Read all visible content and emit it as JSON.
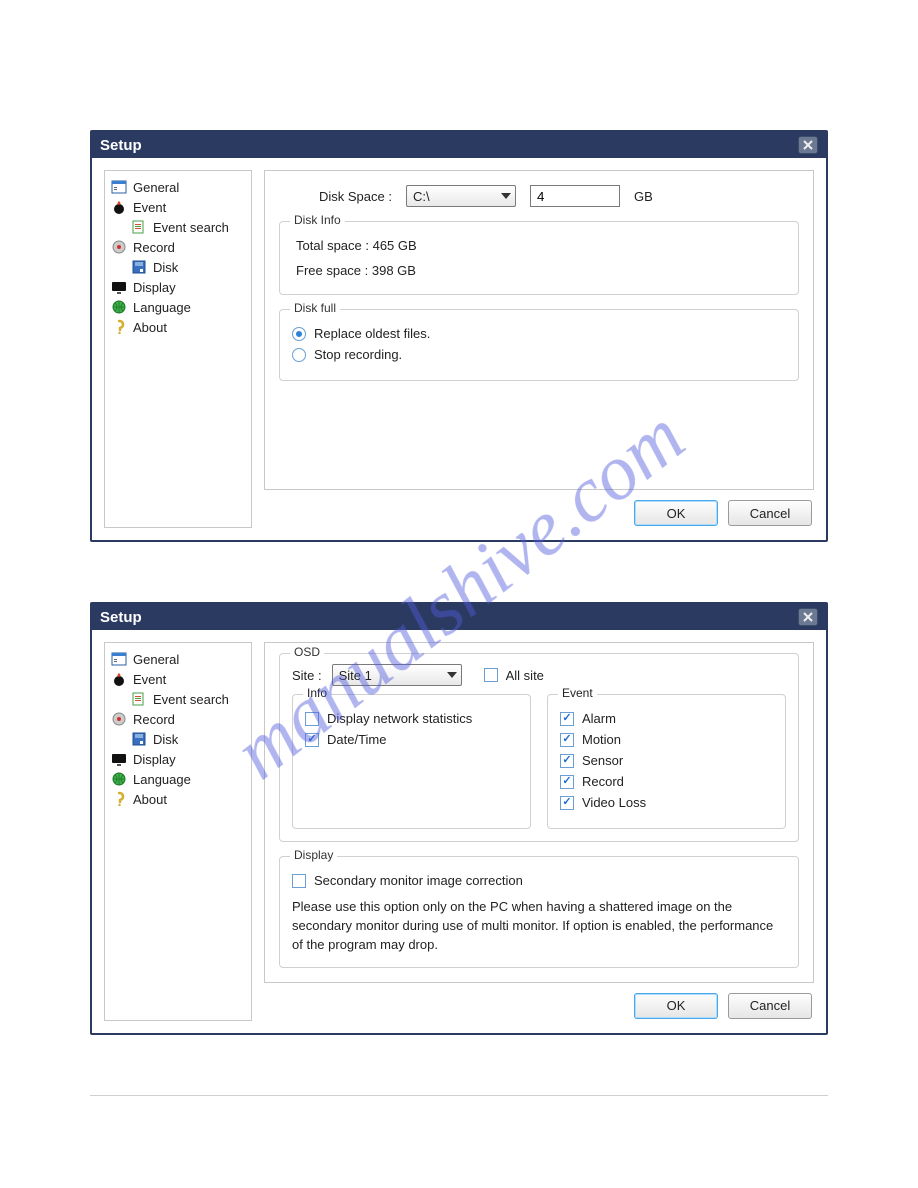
{
  "watermark": "manualshive.com",
  "sidebar": {
    "items": [
      {
        "label": "General",
        "icon": "general-icon"
      },
      {
        "label": "Event",
        "icon": "event-icon"
      },
      {
        "label": "Event search",
        "icon": "event-search-icon",
        "child": true
      },
      {
        "label": "Record",
        "icon": "record-icon"
      },
      {
        "label": "Disk",
        "icon": "disk-icon",
        "child": true
      },
      {
        "label": "Display",
        "icon": "display-icon"
      },
      {
        "label": "Language",
        "icon": "language-icon"
      },
      {
        "label": "About",
        "icon": "about-icon"
      }
    ]
  },
  "dialog1": {
    "title": "Setup",
    "diskSpace": {
      "label": "Disk Space :",
      "drive": "C:\\",
      "size": "4",
      "unit": "GB"
    },
    "diskInfo": {
      "legend": "Disk Info",
      "total": "Total space : 465 GB",
      "free": "Free space : 398 GB"
    },
    "diskFull": {
      "legend": "Disk full",
      "opt1": "Replace oldest files.",
      "opt2": "Stop recording."
    },
    "ok": "OK",
    "cancel": "Cancel"
  },
  "dialog2": {
    "title": "Setup",
    "osd": {
      "legend": "OSD",
      "siteLabel": "Site :",
      "siteValue": "Site 1",
      "allSite": "All site",
      "info": {
        "legend": "Info",
        "opt1": "Display network statistics",
        "opt2": "Date/Time"
      },
      "event": {
        "legend": "Event",
        "items": [
          "Alarm",
          "Motion",
          "Sensor",
          "Record",
          "Video Loss"
        ]
      }
    },
    "display": {
      "legend": "Display",
      "opt": "Secondary monitor image correction",
      "note": "Please use this option only on the PC when having a shattered image on the secondary monitor during use of multi monitor. If option is enabled, the performance of the program may drop."
    },
    "ok": "OK",
    "cancel": "Cancel"
  }
}
